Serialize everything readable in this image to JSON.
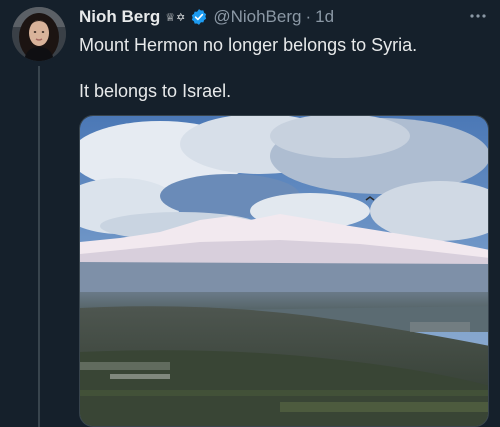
{
  "tweet": {
    "display_name": "Nioh Berg",
    "name_emoji": "♕✡",
    "handle": "@NiohBerg",
    "separator": "·",
    "time": "1d",
    "text_line1": "Mount Hermon no longer belongs to Syria.",
    "text_line2": "It belongs to Israel."
  },
  "icons": {
    "verified": "verified-badge-icon",
    "more": "more-options-icon"
  },
  "colors": {
    "background": "#15202b",
    "verified_blue": "#1d9bf0",
    "secondary_text": "#8b98a5"
  }
}
